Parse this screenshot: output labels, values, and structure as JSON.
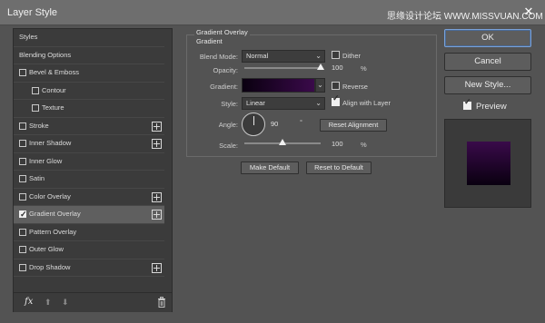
{
  "window": {
    "title": "Layer Style",
    "watermark": "思缘设计论坛 WWW.MISSVUAN.COM",
    "close_glyph": "✕"
  },
  "sidebar": {
    "items": [
      {
        "label": "Styles",
        "type": "head"
      },
      {
        "label": "Blending Options",
        "type": "head"
      },
      {
        "label": "Bevel & Emboss",
        "type": "check",
        "checked": false,
        "plus": false
      },
      {
        "label": "Contour",
        "type": "sub",
        "checked": false,
        "plus": false
      },
      {
        "label": "Texture",
        "type": "sub",
        "checked": false,
        "plus": false
      },
      {
        "label": "Stroke",
        "type": "check",
        "checked": false,
        "plus": true
      },
      {
        "label": "Inner Shadow",
        "type": "check",
        "checked": false,
        "plus": true
      },
      {
        "label": "Inner Glow",
        "type": "check",
        "checked": false,
        "plus": false
      },
      {
        "label": "Satin",
        "type": "check",
        "checked": false,
        "plus": false
      },
      {
        "label": "Color Overlay",
        "type": "check",
        "checked": false,
        "plus": true
      },
      {
        "label": "Gradient Overlay",
        "type": "check",
        "checked": true,
        "plus": true,
        "active": true
      },
      {
        "label": "Pattern Overlay",
        "type": "check",
        "checked": false,
        "plus": false
      },
      {
        "label": "Outer Glow",
        "type": "check",
        "checked": false,
        "plus": false
      },
      {
        "label": "Drop Shadow",
        "type": "check",
        "checked": false,
        "plus": true
      }
    ],
    "fx_label": "fx",
    "up_glyph": "⬆",
    "down_glyph": "⬇"
  },
  "panel": {
    "group_title": "Gradient Overlay",
    "sub_title": "Gradient",
    "blend_mode_label": "Blend Mode:",
    "blend_mode_value": "Normal",
    "dither_label": "Dither",
    "dither_checked": false,
    "opacity_label": "Opacity:",
    "opacity_value": "100",
    "opacity_fraction": 1.0,
    "percent": "%",
    "gradient_label": "Gradient:",
    "reverse_label": "Reverse",
    "reverse_checked": false,
    "style_label": "Style:",
    "style_value": "Linear",
    "align_label": "Align with Layer",
    "align_checked": true,
    "angle_label": "Angle:",
    "angle_value": "90",
    "degree": "°",
    "reset_alignment_label": "Reset Alignment",
    "scale_label": "Scale:",
    "scale_value": "100",
    "scale_fraction": 0.5,
    "make_default_label": "Make Default",
    "reset_default_label": "Reset to Default",
    "chevron": "⌄",
    "gradient_colors": [
      "#0a0010",
      "#3a0a4a"
    ]
  },
  "actions": {
    "ok_label": "OK",
    "cancel_label": "Cancel",
    "new_style_label": "New Style...",
    "preview_label": "Preview",
    "preview_checked": true
  }
}
